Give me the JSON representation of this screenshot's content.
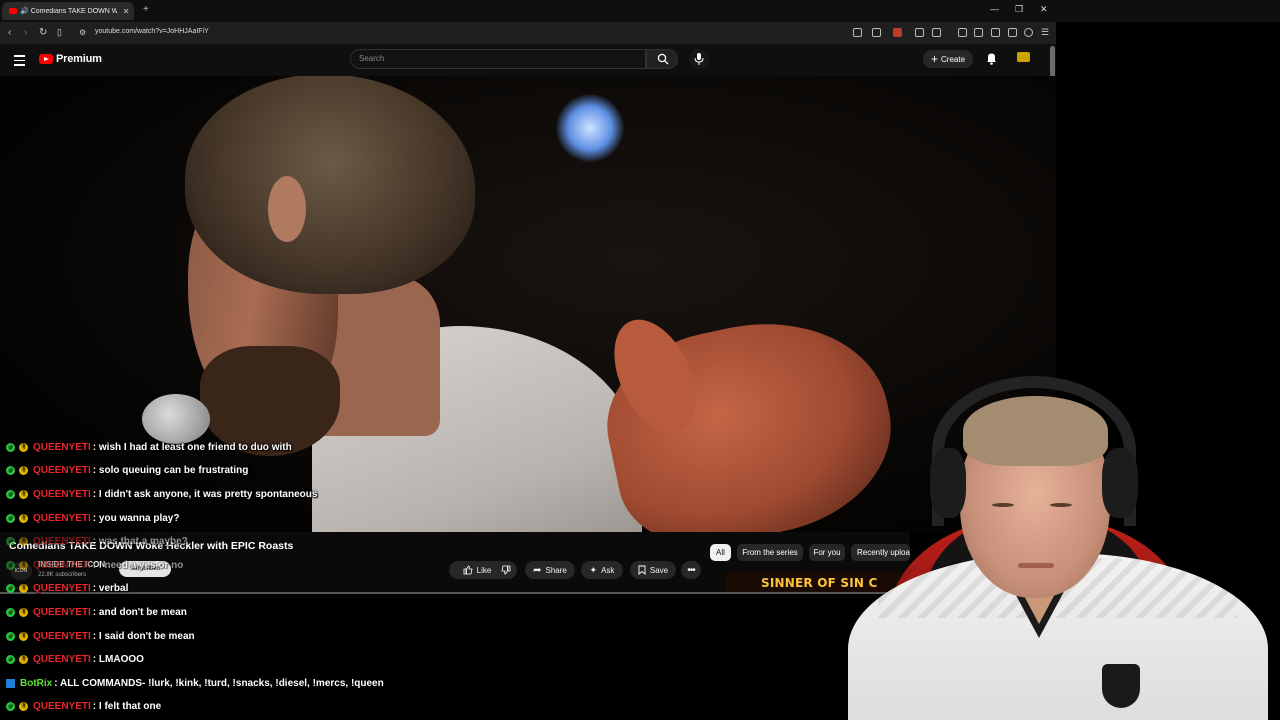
{
  "browser": {
    "tab_title": "Comedians TAKE DOWN Wo...",
    "url": "youtube.com/watch?v=JoHHJAaIFiY",
    "new_tab": "+",
    "minimize": "—",
    "restore": "❐",
    "close": "✕"
  },
  "youtube": {
    "logo_text": "Premium",
    "search_placeholder": "Search",
    "create_label": "Create",
    "video_title": "Comedians TAKE DOWN Woke Heckler with EPIC Roasts",
    "channel_name": "INSIDE THE ICON",
    "channel_avatar_text": "ICON",
    "subscribers": "22.8K subscribers",
    "subscribe_label": "Subscribed",
    "actions": {
      "like": "Like",
      "share": "Share",
      "ask": "Ask",
      "save": "Save"
    },
    "chips": [
      "All",
      "From the series",
      "For you",
      "Recently uploaded"
    ],
    "up_next_thumb_text": "SINNER OF SIN C"
  },
  "chat": [
    {
      "user": "QUEENYETI",
      "text": ": wish I had at least one friend to duo with",
      "badge": "mod"
    },
    {
      "user": "QUEENYETI",
      "text": ": solo queuing can be frustrating",
      "badge": "mod"
    },
    {
      "user": "QUEENYETI",
      "text": ": I didn't ask anyone, it was pretty spontaneous",
      "badge": "mod"
    },
    {
      "user": "QUEENYETI",
      "text": ": you wanna play?",
      "badge": "mod"
    },
    {
      "user": "QUEENYETI",
      "text": ": was that a maybe?",
      "badge": "mod"
    },
    {
      "user": "QUEENYETI",
      "text": ": I need a yes or no",
      "badge": "mod"
    },
    {
      "user": "QUEENYETI",
      "text": ": verbal",
      "badge": "mod"
    },
    {
      "user": "QUEENYETI",
      "text": ": and don't be mean",
      "badge": "mod"
    },
    {
      "user": "QUEENYETI",
      "text": ": I said don't be mean",
      "badge": "mod"
    },
    {
      "user": "QUEENYETI",
      "text": ": LMAOOO",
      "badge": "mod"
    },
    {
      "user": "BotRix",
      "text": ": ALL COMMANDS- !lurk, !kink, !turd, !snacks, !diesel, !mercs, !queen",
      "badge": "bot"
    },
    {
      "user": "QUEENYETI",
      "text": ": I felt that one",
      "badge": "mod"
    }
  ],
  "colors": {
    "queenyeti": "#e8262b",
    "botrix": "#5fe03a",
    "youtube_red": "#ff0000",
    "thumb_text": "#ffc23a"
  },
  "icons": [
    "speaker-icon",
    "back-icon",
    "forward-icon",
    "reload-icon",
    "bookmark-icon",
    "search-icon",
    "mic-icon",
    "plus-icon",
    "bell-icon",
    "like-icon",
    "dislike-icon",
    "share-icon",
    "ask-icon",
    "save-icon",
    "more-icon"
  ]
}
